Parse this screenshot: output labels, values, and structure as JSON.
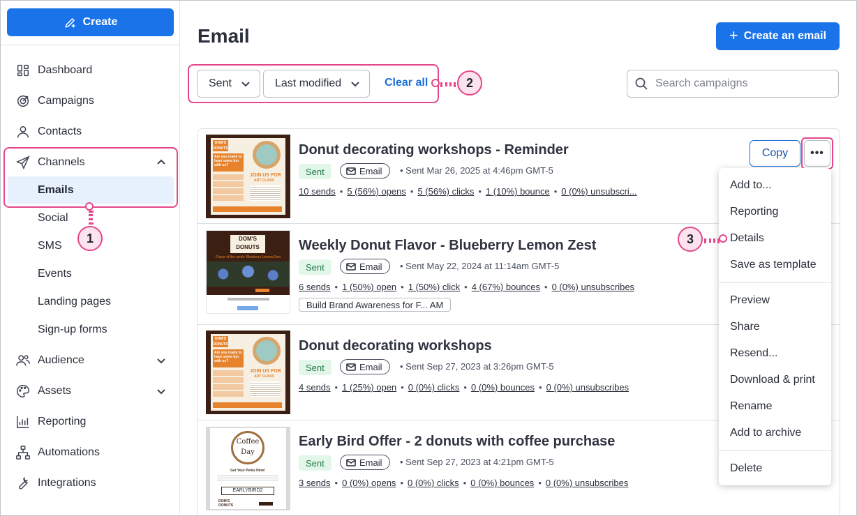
{
  "sidebar": {
    "create_label": "Create",
    "nav": [
      {
        "label": "Dashboard",
        "icon": "dashboard-icon"
      },
      {
        "label": "Campaigns",
        "icon": "target-icon"
      },
      {
        "label": "Contacts",
        "icon": "person-icon"
      },
      {
        "label": "Channels",
        "icon": "paper-plane-icon",
        "expanded": true
      },
      {
        "label": "Audience",
        "icon": "people-icon"
      },
      {
        "label": "Assets",
        "icon": "palette-icon"
      },
      {
        "label": "Reporting",
        "icon": "chart-icon"
      },
      {
        "label": "Automations",
        "icon": "flow-icon"
      },
      {
        "label": "Integrations",
        "icon": "wrench-icon"
      }
    ],
    "channels_sub": [
      "Emails",
      "Social",
      "SMS",
      "Events",
      "Landing pages",
      "Sign-up forms"
    ]
  },
  "header": {
    "title": "Email",
    "create_email_label": "Create an email"
  },
  "filters": {
    "status": "Sent",
    "sort": "Last modified",
    "clear_label": "Clear all",
    "search_placeholder": "Search campaigns"
  },
  "callouts": [
    "1",
    "2",
    "3"
  ],
  "campaigns": [
    {
      "title": "Donut decorating workshops - Reminder",
      "status": "Sent",
      "type": "Email",
      "sent_info": "• Sent Mar 26, 2025 at 4:46pm GMT-5",
      "stats": [
        "10 sends",
        "5 (56%) opens",
        "5 (56%) clicks",
        "1 (10%) bounce",
        "0 (0%) unsubscri..."
      ]
    },
    {
      "title": "Weekly Donut Flavor - Blueberry Lemon Zest",
      "status": "Sent",
      "type": "Email",
      "sent_info": "• Sent May 22, 2024 at 11:14am GMT-5",
      "stats": [
        "6 sends",
        "1 (50%) open",
        "1 (50%) click",
        "4 (67%) bounces",
        "0 (0%) unsubscribes"
      ],
      "campaign_tag": "Build Brand Awareness for F...   AM"
    },
    {
      "title": "Donut decorating workshops",
      "status": "Sent",
      "type": "Email",
      "sent_info": "• Sent Sep 27, 2023 at 3:26pm GMT-5",
      "stats": [
        "4 sends",
        "1 (25%) open",
        "0 (0%) clicks",
        "0 (0%) bounces",
        "0 (0%) unsubscribes"
      ]
    },
    {
      "title": "Early Bird Offer - 2 donuts with coffee purchase",
      "status": "Sent",
      "type": "Email",
      "sent_info": "• Sent Sep 27, 2023 at 4:21pm GMT-5",
      "stats": [
        "3 sends",
        "0 (0%) opens",
        "0 (0%) clicks",
        "0 (0%) bounces",
        "0 (0%) unsubscribes"
      ]
    }
  ],
  "row_actions": {
    "copy_label": "Copy",
    "more_label": "•••"
  },
  "menu": {
    "group1": [
      "Add to...",
      "Reporting",
      "Details",
      "Save as template"
    ],
    "group2": [
      "Preview",
      "Share",
      "Resend...",
      "Download & print",
      "Rename",
      "Add to archive"
    ],
    "group3": [
      "Delete"
    ]
  },
  "thumbnails": {
    "brand": "DOM'S DONUTS",
    "donut_headline": "Are you ready to have some fun with us?",
    "donut_join": "JOIN US FOR",
    "donut_class": "ART CLASS",
    "weekly_headline": "Flavor of the week: Blueberry Lemon Zest",
    "coffee_brand": "Coffee Day",
    "coffee_headline": "Get Your Perks Here!",
    "coffee_code": "EARLYBIRD2"
  },
  "colors": {
    "primary": "#1a73e8",
    "highlight": "#e5468a",
    "sent_bg": "#e3f6ea",
    "sent_text": "#1e7a45",
    "active_bg": "#e7f0fd"
  }
}
